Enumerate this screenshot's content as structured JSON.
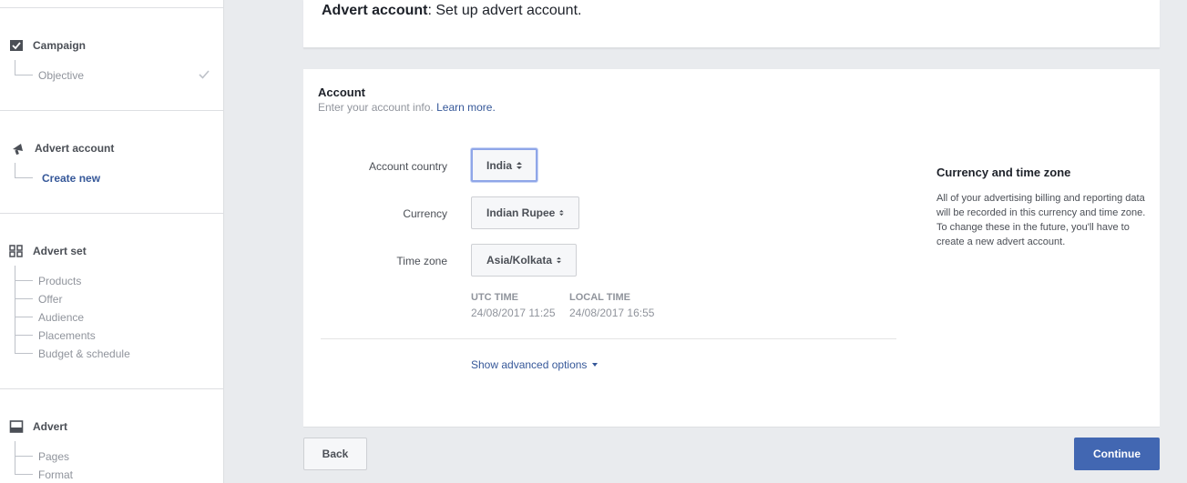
{
  "sidebar": {
    "campaign": {
      "title": "Campaign",
      "items": [
        {
          "label": "Objective",
          "done": true
        }
      ]
    },
    "advert_account": {
      "title": "Advert account",
      "items": [
        {
          "label": "Create new",
          "active": true
        }
      ]
    },
    "advert_set": {
      "title": "Advert set",
      "items": [
        {
          "label": "Products"
        },
        {
          "label": "Offer"
        },
        {
          "label": "Audience"
        },
        {
          "label": "Placements"
        },
        {
          "label": "Budget & schedule"
        }
      ]
    },
    "advert": {
      "title": "Advert",
      "items": [
        {
          "label": "Pages"
        },
        {
          "label": "Format"
        }
      ]
    }
  },
  "header": {
    "title_bold": "Advert account",
    "title_rest": ": Set up advert account."
  },
  "account": {
    "title": "Account",
    "subtitle": "Enter your account info.",
    "learn_more": "Learn more.",
    "fields": {
      "country": {
        "label": "Account country",
        "value": "India"
      },
      "currency": {
        "label": "Currency",
        "value": "Indian Rupee"
      },
      "timezone": {
        "label": "Time zone",
        "value": "Asia/Kolkata"
      }
    },
    "utc": {
      "label": "UTC TIME",
      "value": "24/08/2017 11:25"
    },
    "local": {
      "label": "LOCAL TIME",
      "value": "24/08/2017 16:55"
    },
    "advanced_link": "Show advanced options",
    "info": {
      "title": "Currency and time zone",
      "text": "All of your advertising billing and reporting data will be recorded in this currency and time zone. To change these in the future, you'll have to create a new advert account."
    }
  },
  "footer": {
    "back_label": "Back",
    "continue_label": "Continue"
  },
  "colors": {
    "primary": "#4267b2",
    "link": "#365899",
    "muted": "#90949c",
    "background": "#e9ebee"
  }
}
